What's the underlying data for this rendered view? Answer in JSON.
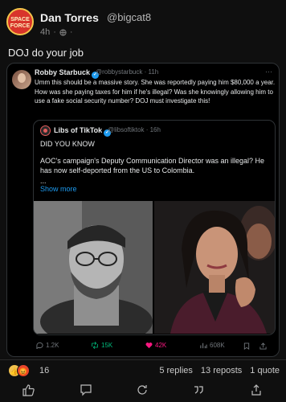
{
  "post": {
    "author_name": "Dan Torres",
    "author_handle": "@bigcat8",
    "timestamp": "4h",
    "avatar_text": "SPACE FORCE",
    "body": "DOJ do your job"
  },
  "embedded_tweet": {
    "author_name": "Robby Starbuck",
    "author_handle": "@robbystarbuck · 11h",
    "more": "···",
    "text": "Umm this should be a massive story. She was reportedly paying him $80,000 a year. How was she paying taxes for him if he's illegal? Was she knowingly allowing him to use a fake social security number? DOJ must investigate this!",
    "quote": {
      "author_name": "Libs of TikTok",
      "author_handle": "@libsoftiktok · 16h",
      "line1": "DID YOU KNOW",
      "line2": "AOC's campaign's Deputy Communication Director was an illegal? He has now self-deported from the US to Colombia.",
      "ellipsis": "...",
      "show_more": "Show more"
    },
    "actions": {
      "replies": "1.2K",
      "reposts": "15K",
      "likes": "42K",
      "views": "608K"
    }
  },
  "footer": {
    "reaction_count": "16",
    "replies": "5 replies",
    "reposts": "13 reposts",
    "quotes": "1 quote"
  },
  "colors": {
    "background": "#0f0f0f",
    "repost_green": "#00ba7c",
    "like_pink": "#f91880",
    "link_blue": "#1d9bf0"
  },
  "icons": [
    "like-icon",
    "comment-icon",
    "repost-icon",
    "quote-icon",
    "share-icon"
  ]
}
